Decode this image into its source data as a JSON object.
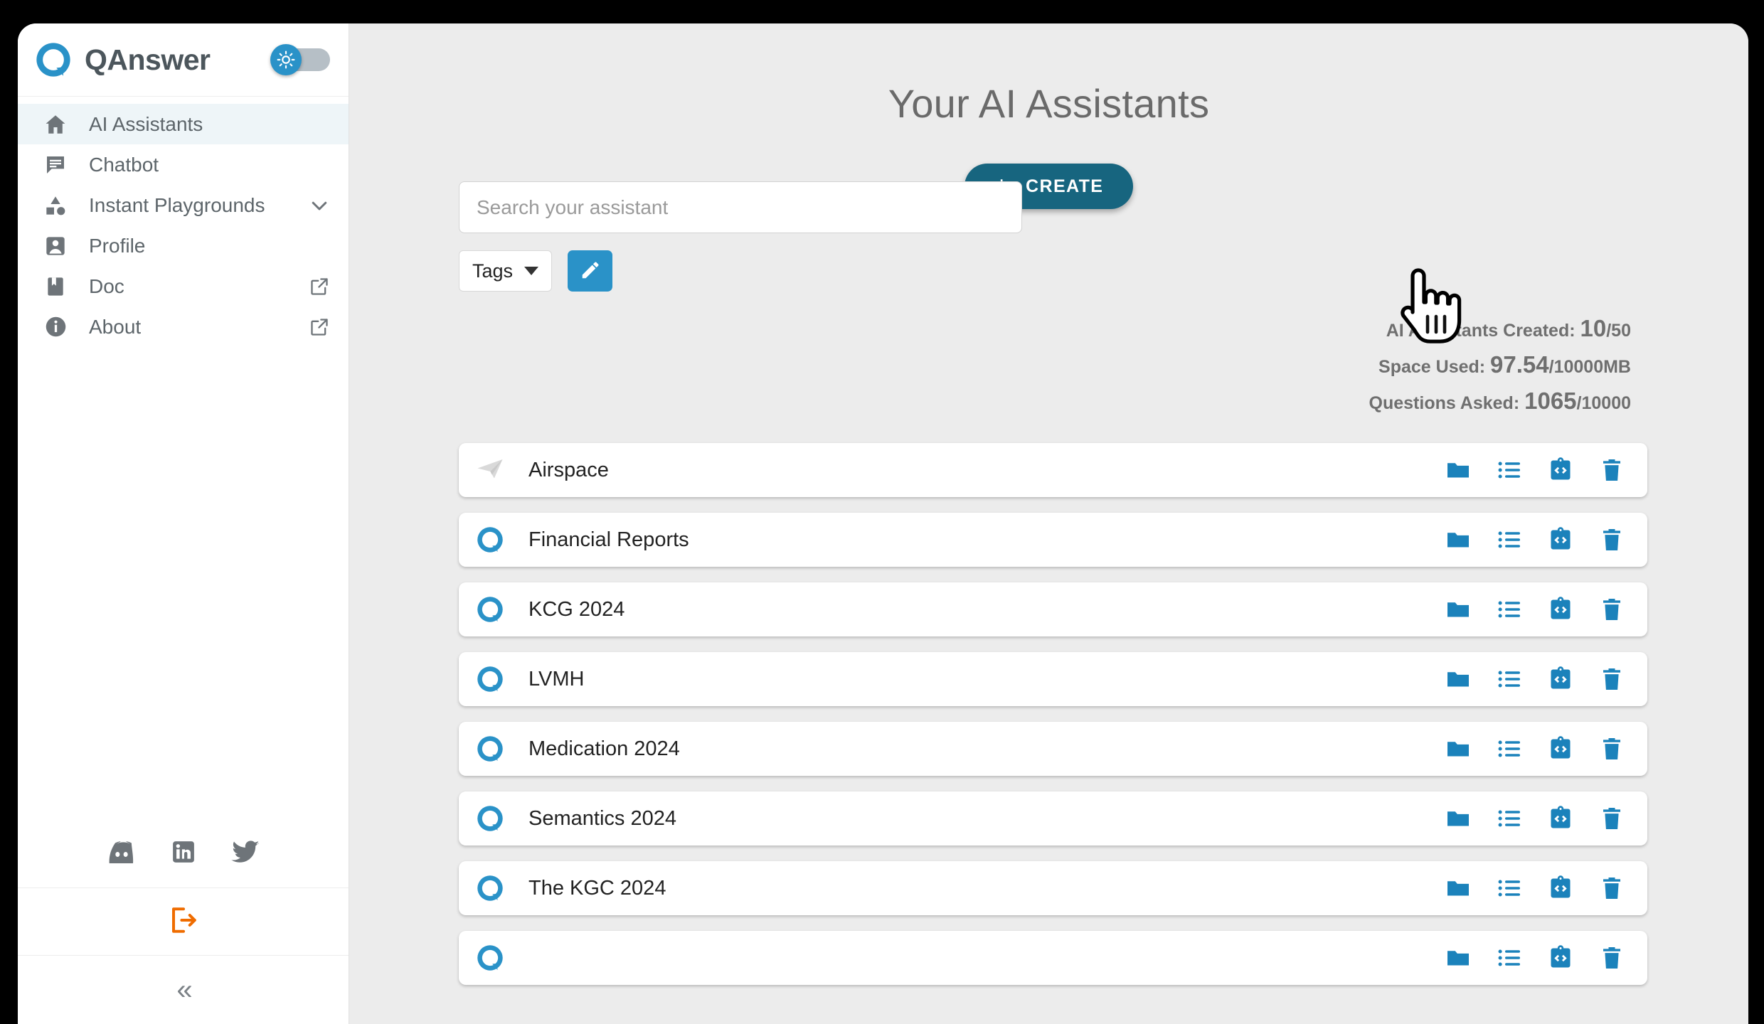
{
  "brand": {
    "name": "QAnswer",
    "logo_icon": "qanswer-logo-icon",
    "theme_toggle_icon": "sun-icon"
  },
  "sidebar": {
    "items": [
      {
        "label": "AI Assistants",
        "icon": "home-icon",
        "active": true,
        "trailing": "none"
      },
      {
        "label": "Chatbot",
        "icon": "chat-icon",
        "active": false,
        "trailing": "none"
      },
      {
        "label": "Instant Playgrounds",
        "icon": "shapes-icon",
        "active": false,
        "trailing": "chevron-down-icon"
      },
      {
        "label": "Profile",
        "icon": "person-icon",
        "active": false,
        "trailing": "none"
      },
      {
        "label": "Doc",
        "icon": "bookmark-icon",
        "active": false,
        "trailing": "external-link-icon"
      },
      {
        "label": "About",
        "icon": "info-icon",
        "active": false,
        "trailing": "external-link-icon"
      }
    ],
    "social": [
      {
        "icon": "discord-icon"
      },
      {
        "icon": "linkedin-icon"
      },
      {
        "icon": "twitter-icon"
      }
    ],
    "logout_icon": "logout-icon",
    "collapse_icon": "chevron-double-left-icon",
    "collapse_label": "«"
  },
  "main": {
    "title": "Your AI Assistants",
    "create_button": {
      "label": "CREATE",
      "plus": "+",
      "icon": "plus-icon"
    },
    "search": {
      "placeholder": "Search your assistant",
      "value": ""
    },
    "tags_button": {
      "label": "Tags",
      "icon": "chevron-down-icon"
    },
    "edit_button": {
      "icon": "pencil-icon"
    }
  },
  "quota": {
    "assistants": {
      "label": "AI Assistants Created:",
      "used": "10",
      "total": "/50"
    },
    "space": {
      "label": "Space Used:",
      "used": "97.54",
      "total": "/10000MB"
    },
    "questions": {
      "label": "Questions Asked:",
      "used": "1065",
      "total": "/10000"
    }
  },
  "assistants": [
    {
      "name": "Airspace",
      "avatar": "paper-plane-icon"
    },
    {
      "name": "Financial Reports",
      "avatar": "qanswer-logo-icon"
    },
    {
      "name": "KCG 2024",
      "avatar": "qanswer-logo-icon"
    },
    {
      "name": "LVMH",
      "avatar": "qanswer-logo-icon"
    },
    {
      "name": "Medication 2024",
      "avatar": "qanswer-logo-icon"
    },
    {
      "name": "Semantics 2024",
      "avatar": "qanswer-logo-icon"
    },
    {
      "name": "The KGC 2024",
      "avatar": "qanswer-logo-icon"
    },
    {
      "name": "",
      "avatar": "qanswer-logo-icon"
    }
  ],
  "row_actions": [
    {
      "icon": "folder-icon"
    },
    {
      "icon": "list-icon"
    },
    {
      "icon": "embed-code-icon"
    },
    {
      "icon": "trash-icon"
    }
  ],
  "colors": {
    "brand_blue": "#2a92c8",
    "create_teal": "#17657f",
    "action_blue": "#1b82bb",
    "logout_orange": "#ef6c00",
    "page_bg": "#ececec",
    "active_nav": "#eef5f8",
    "text_grey": "#6a6a6a"
  },
  "cursor": {
    "icon": "pointing-hand-cursor"
  }
}
